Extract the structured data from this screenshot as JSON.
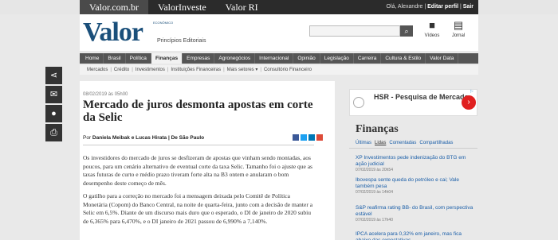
{
  "topbar": {
    "tabs": [
      "Valor.com.br",
      "ValorInveste",
      "Valor RI"
    ],
    "greeting": "Olá, Alexandre | ",
    "edit_profile": "Editar perfil",
    "separator": " | ",
    "logout": "Sair"
  },
  "header": {
    "logo": "Valor",
    "logo_small": "ECONÔMICO",
    "principios": "Princípios Editoriais",
    "videos": "Vídeos",
    "jornal": "Jornal"
  },
  "mainnav": [
    "Home",
    "Brasil",
    "Política",
    "Finanças",
    "Empresas",
    "Agronegócios",
    "Internacional",
    "Opinião",
    "Legislação",
    "Carreira",
    "Cultura & Estilo",
    "Valor Data"
  ],
  "mainnav_active": "Finanças",
  "subnav": [
    "Mercados",
    "Crédito",
    "Investimentos",
    "Instituições Financeiras",
    "Mais setores",
    "Consultório Financeiro"
  ],
  "article": {
    "date": "08/02/2019 às 05h00",
    "headline": "Mercado de juros desmonta apostas em corte da Selic",
    "byline_prefix": "Por ",
    "authors": "Daniela Meibak e Lucas Hirata",
    "byline_suffix": " | De São Paulo",
    "paragraphs": [
      "Os investidores do mercado de juros se desfizeram de apostas que vinham sendo montadas, aos poucos, para um cenário alternativo de eventual corte da taxa Selic. Tamanho foi o ajuste que as taxas futuras de curto e médio prazo tiveram forte alta na B3 ontem e anularam o bom desempenho deste começo de mês.",
      "O gatilho para a correção no mercado foi a mensagem deixada pelo Comitê de Política Monetária (Copom) do Banco Central, na noite de quarta-feira, junto com a decisão de manter a Selic em 6,5%. Diante de um discurso mais duro que o esperado, o DI de janeiro de 2020 subiu de 6,365% para 6,470%, e o DI janeiro de 2021 passou de 6,990% a 7,140%."
    ]
  },
  "ad": {
    "text": "HSR - Pesquisa de Mercado",
    "cta_icon": "chevron-right-icon"
  },
  "sidebar": {
    "title": "Finanças",
    "tabs": [
      "Últimas",
      "Lidas",
      "Comentadas",
      "Compartilhadas"
    ],
    "active_tab": "Lidas",
    "news": [
      {
        "headline": "XP Investimentos pede indenização do BTG em ação judicial",
        "time": "07/02/2019 às 20h54"
      },
      {
        "headline": "Ibovespa sente queda do petróleo e cai; Vale também pesa",
        "time": "07/02/2019 às 14h04"
      },
      {
        "headline": "S&P reafirma rating BB- do Brasil, com perspectiva estável",
        "time": "07/02/2019 às 17h40"
      },
      {
        "headline": "IPCA acelera para 0,32% em janeiro, mas fica abaixo das expectativas",
        "time": ""
      }
    ]
  },
  "colors": {
    "brand": "#1a4f7a",
    "nav_bg": "#555555",
    "topbar_bg": "#2b2b2b",
    "link": "#1a5ea8",
    "ad_cta": "#e02020"
  }
}
